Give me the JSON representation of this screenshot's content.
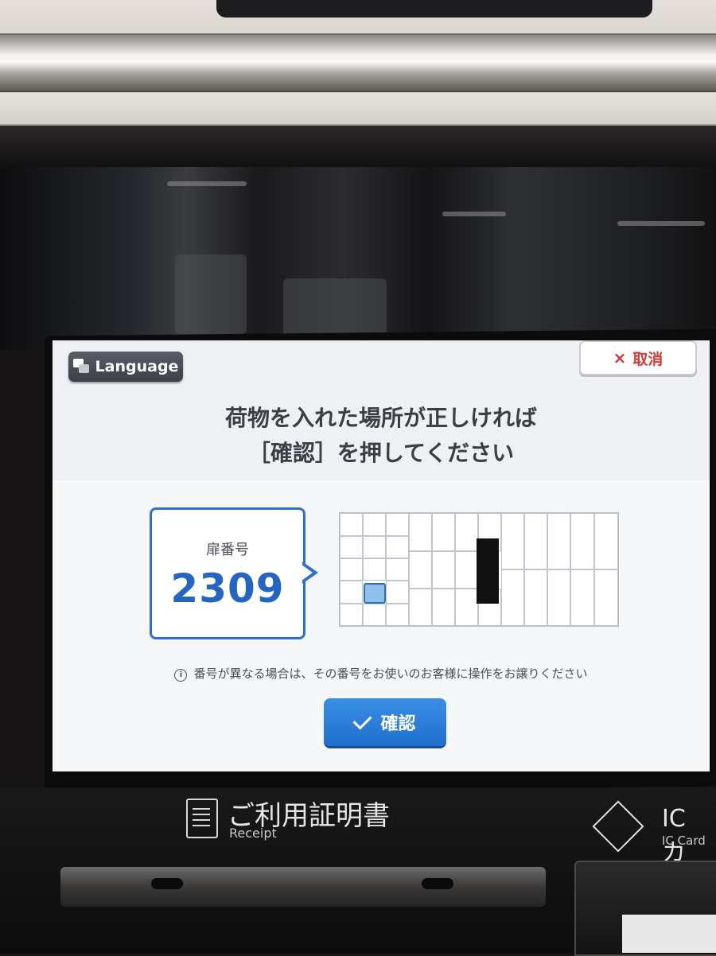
{
  "screen": {
    "language_button": {
      "label": "Language",
      "icon": "translate-icon"
    },
    "cancel_button": {
      "label": "取消",
      "icon": "close-icon",
      "icon_glyph": "×"
    },
    "instruction": {
      "line1": "荷物を入れた場所が正しければ",
      "line2": "［確認］を押してください"
    },
    "door": {
      "label": "扉番号",
      "number": "2309"
    },
    "locker_map": {
      "selected_locker": "2309",
      "accent_color": "#2f6fd0"
    },
    "notice": "番号が異なる場合は、その番号をお使いのお客様に操作をお譲りください",
    "confirm_button": {
      "label": "確認",
      "icon": "check-icon"
    }
  },
  "machine": {
    "receipt": {
      "label_ja": "ご利用証明書",
      "label_en": "Receipt"
    },
    "ic_card": {
      "label": "IC カ",
      "sub": "IC Card"
    }
  }
}
